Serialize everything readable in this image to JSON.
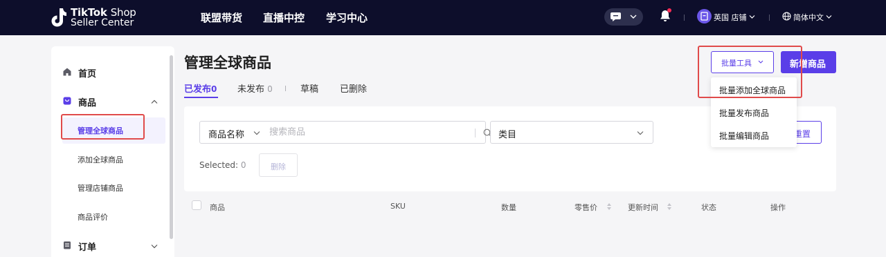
{
  "topbar": {
    "logo_brand": "TikTok",
    "logo_brand_suffix": "Shop",
    "logo_sub": "Seller Center",
    "nav": [
      "联盟带货",
      "直播中控",
      "学习中心"
    ],
    "store_label": "英国 店铺",
    "lang_label": "简体中文"
  },
  "sidebar": {
    "home": "首页",
    "products": "商品",
    "sub_items": [
      "管理全球商品",
      "添加全球商品",
      "管理店铺商品",
      "商品评价"
    ],
    "orders": "订单"
  },
  "page": {
    "title": "管理全球商品",
    "tabs": [
      {
        "label": "已发布",
        "count": "0"
      },
      {
        "label": "未发布",
        "count": "0"
      },
      {
        "label": "草稿",
        "count": ""
      },
      {
        "label": "已删除",
        "count": ""
      }
    ],
    "batch_tools_label": "批量工具",
    "new_product_label": "新增商品"
  },
  "dropdown": {
    "items": [
      "批量添加全球商品",
      "批量发布商品",
      "批量编辑商品"
    ]
  },
  "filters": {
    "field_label": "商品名称",
    "search_placeholder": "搜索商品",
    "category_label": "类目",
    "reset_label": "重置",
    "selected_label": "Selected:",
    "selected_count": "0",
    "delete_label": "删除"
  },
  "table": {
    "columns": [
      "商品",
      "SKU",
      "数量",
      "零售价",
      "更新时间",
      "状态",
      "操作"
    ]
  },
  "colors": {
    "topbar_bg": "#0d0e2b",
    "accent": "#5a3ee8",
    "highlight_box": "#e04a4a",
    "notification_dot": "#fe2c55"
  }
}
